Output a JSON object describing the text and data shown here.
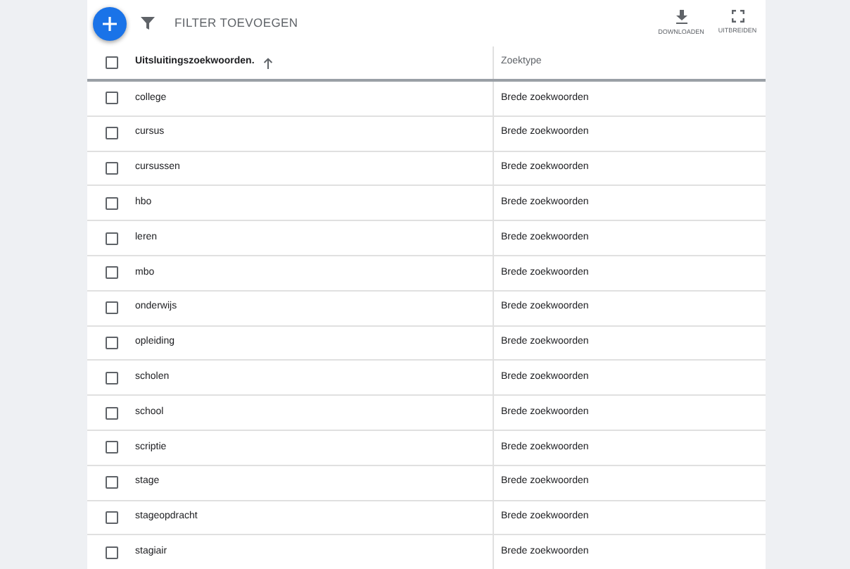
{
  "toolbar": {
    "filter_label": "FILTER TOEVOEGEN",
    "actions": [
      {
        "kind": "download",
        "label": "DOWNLOADEN"
      },
      {
        "kind": "expand",
        "label": "UITBREIDEN"
      }
    ]
  },
  "table": {
    "columns": [
      {
        "label": "Uitsluitingszoekwoorden.",
        "sorted": true
      },
      {
        "label": "Zoektype",
        "sorted": false
      }
    ],
    "header_checked": false,
    "rows": [
      {
        "keyword": "college",
        "type": "Brede zoekwoorden",
        "checked": false
      },
      {
        "keyword": "cursus",
        "type": "Brede zoekwoorden",
        "checked": false
      },
      {
        "keyword": "cursussen",
        "type": "Brede zoekwoorden",
        "checked": false
      },
      {
        "keyword": "hbo",
        "type": "Brede zoekwoorden",
        "checked": false
      },
      {
        "keyword": "leren",
        "type": "Brede zoekwoorden",
        "checked": false
      },
      {
        "keyword": "mbo",
        "type": "Brede zoekwoorden",
        "checked": false
      },
      {
        "keyword": "onderwijs",
        "type": "Brede zoekwoorden",
        "checked": false
      },
      {
        "keyword": "opleiding",
        "type": "Brede zoekwoorden",
        "checked": false
      },
      {
        "keyword": "scholen",
        "type": "Brede zoekwoorden",
        "checked": false
      },
      {
        "keyword": "school",
        "type": "Brede zoekwoorden",
        "checked": false
      },
      {
        "keyword": "scriptie",
        "type": "Brede zoekwoorden",
        "checked": false
      },
      {
        "keyword": "stage",
        "type": "Brede zoekwoorden",
        "checked": false
      },
      {
        "keyword": "stageopdracht",
        "type": "Brede zoekwoorden",
        "checked": false
      },
      {
        "keyword": "stagiair",
        "type": "Brede zoekwoorden",
        "checked": false
      }
    ]
  }
}
